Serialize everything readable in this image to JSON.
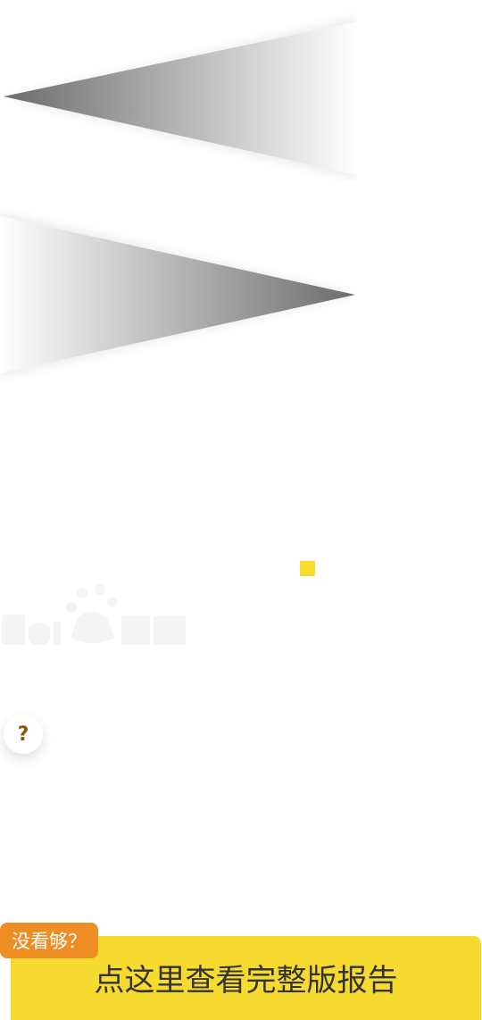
{
  "decor": {
    "left_arrow": "left-arrow-icon",
    "right_arrow": "right-arrow-icon"
  },
  "help": {
    "symbol": "?"
  },
  "cta": {
    "badge_text": "没看够？",
    "label": "点这里查看完整版报告",
    "color": "#f6da30",
    "badge_color": "#ee8d22"
  },
  "colors": {
    "accent_square": "#f7dc2e",
    "help_text": "#8a5a0c"
  }
}
